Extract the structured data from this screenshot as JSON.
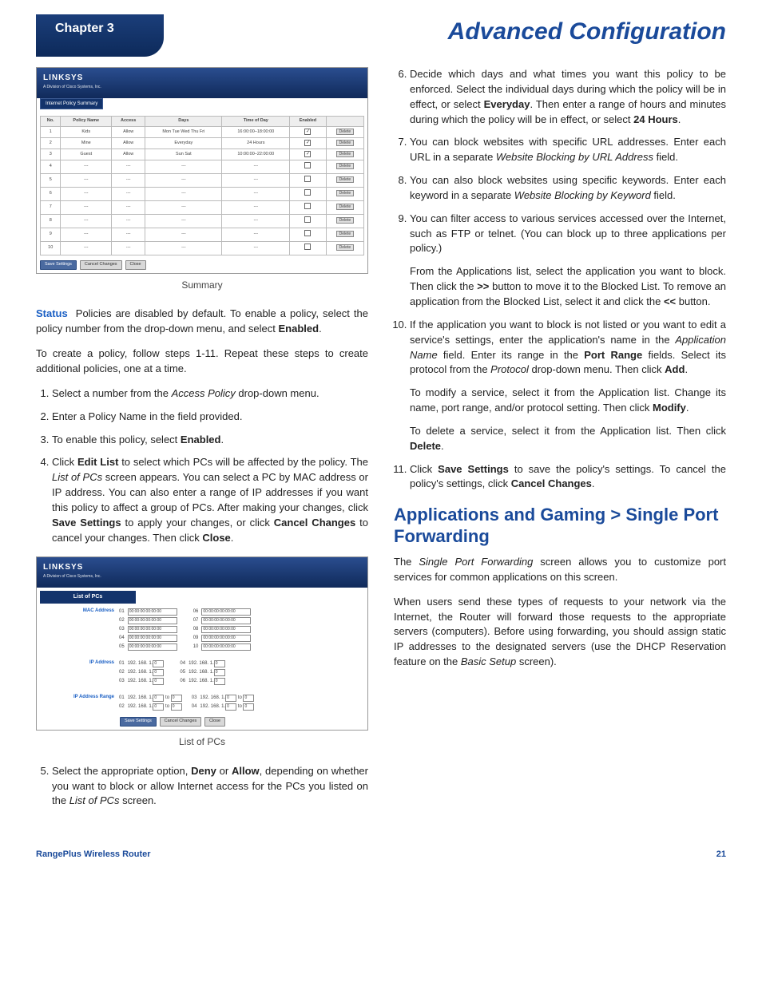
{
  "header": {
    "chapter": "Chapter 3",
    "title": "Advanced Configuration"
  },
  "footer": {
    "product": "RangePlus Wireless Router",
    "page": "21"
  },
  "fig1": {
    "logo": "LINKSYS",
    "sublogo": "A Division of Cisco Systems, Inc.",
    "tab": "Internet Policy Summary",
    "headers": [
      "No.",
      "Policy Name",
      "Access",
      "Days",
      "Time of Day",
      "Enabled",
      ""
    ],
    "rows": [
      [
        "1",
        "Kids",
        "Allow",
        "Mon Tue Wed Thu Fri",
        "16:00:00–18:00:00",
        "✓",
        "Delete"
      ],
      [
        "2",
        "Mine",
        "Allow",
        "Everyday",
        "24 Hours",
        "✓",
        "Delete"
      ],
      [
        "3",
        "Guest",
        "Allow",
        "Sun Sat",
        "10:00:00–22:00:00",
        "✓",
        "Delete"
      ],
      [
        "4",
        "---",
        "---",
        "---",
        "---",
        "",
        "Delete"
      ],
      [
        "5",
        "---",
        "---",
        "---",
        "---",
        "",
        "Delete"
      ],
      [
        "6",
        "---",
        "---",
        "---",
        "---",
        "",
        "Delete"
      ],
      [
        "7",
        "---",
        "---",
        "---",
        "---",
        "",
        "Delete"
      ],
      [
        "8",
        "---",
        "---",
        "---",
        "---",
        "",
        "Delete"
      ],
      [
        "9",
        "---",
        "---",
        "---",
        "---",
        "",
        "Delete"
      ],
      [
        "10",
        "---",
        "---",
        "---",
        "---",
        "",
        "Delete"
      ]
    ],
    "buttons": [
      "Save Settings",
      "Cancel Changes",
      "Close"
    ],
    "caption": "Summary"
  },
  "left": {
    "status_lead": "Status",
    "status_text": "Policies are disabled by default. To enable a policy, select the policy number from the drop-down menu, and select Enabled.",
    "create_text": "To create a policy, follow steps 1-11. Repeat these steps to create additional policies, one at a time.",
    "step1": "Select a number from the Access Policy drop-down menu.",
    "step2": "Enter a Policy Name in the field provided.",
    "step3": "To enable this policy, select Enabled.",
    "step4": "Click Edit List to select which PCs will be affected by the policy. The List of PCs screen appears. You can select a PC by MAC address or IP address. You can also enter a range of IP addresses if you want this policy to affect a group of PCs. After making your changes, click Save Settings to apply your changes, or click Cancel Changes to cancel your changes. Then click Close.",
    "step5": "Select the appropriate option, Deny or Allow, depending on whether you want to block or allow Internet access for the PCs you listed on the List of PCs screen."
  },
  "fig2": {
    "logo": "LINKSYS",
    "sublogo": "A Division of Cisco Systems, Inc.",
    "section": "List of PCs",
    "mac_label": "MAC Address",
    "mac_rows": [
      [
        "01",
        "00:00:00:00:00:00",
        "06",
        "00:00:00:00:00:00"
      ],
      [
        "02",
        "00:00:00:00:00:00",
        "07",
        "00:00:00:00:00:00"
      ],
      [
        "03",
        "00:00:00:00:00:00",
        "08",
        "00:00:00:00:00:00"
      ],
      [
        "04",
        "00:00:00:00:00:00",
        "09",
        "00:00:00:00:00:00"
      ],
      [
        "05",
        "00:00:00:00:00:00",
        "10",
        "00:00:00:00:00:00"
      ]
    ],
    "ip_label": "IP Address",
    "ip_prefix": "192. 168. 1.",
    "ip_rows": [
      [
        "01",
        "0",
        "04",
        "0"
      ],
      [
        "02",
        "0",
        "05",
        "0"
      ],
      [
        "03",
        "0",
        "06",
        "0"
      ]
    ],
    "range_label": "IP Address Range",
    "to": "to",
    "range_rows": [
      [
        "01",
        "0",
        "0",
        "03",
        "0",
        "0"
      ],
      [
        "02",
        "0",
        "0",
        "04",
        "0",
        "0"
      ]
    ],
    "buttons": [
      "Save Settings",
      "Cancel Changes",
      "Close"
    ],
    "caption": "List of PCs"
  },
  "right": {
    "step6": "Decide which days and what times you want this policy to be enforced. Select the individual days during which the policy will be in effect, or select Everyday. Then enter a range of hours and minutes during which the policy will be in effect, or select 24 Hours.",
    "step7": "You can block websites with specific URL addresses. Enter each URL in a separate Website Blocking by URL Address field.",
    "step8": "You can also block websites using specific keywords. Enter each keyword in a separate Website Blocking by Keyword field.",
    "step9a": "You can filter access to various services accessed over the Internet, such as FTP or telnet. (You can block up to three applications per policy.)",
    "step9b": "From the Applications list, select the application you want to block. Then click the >> button to move it to the Blocked List. To remove an application from the Blocked List, select it and click the << button.",
    "step10a": "If the application you want to block is not listed or you want to edit a service's settings, enter the application's name in the Application Name field. Enter its range in the Port Range fields. Select its protocol from the Protocol drop-down menu. Then click Add.",
    "step10b": "To modify a service, select it from the Application list. Change its name, port range, and/or protocol setting. Then click Modify.",
    "step10c": "To delete a service, select it from the Application list. Then click Delete.",
    "step11": "Click Save Settings to save the policy's settings. To cancel the policy's settings, click Cancel Changes.",
    "section_title": "Applications and Gaming > Single Port Forwarding",
    "sp1": "The Single Port Forwarding screen allows you to customize port services for common applications on this screen.",
    "sp2": "When users send these types of requests to your network via the Internet, the Router will forward those requests to the appropriate servers (computers). Before using forwarding, you should assign static IP addresses to the designated servers (use the DHCP Reservation feature on the Basic Setup screen)."
  }
}
